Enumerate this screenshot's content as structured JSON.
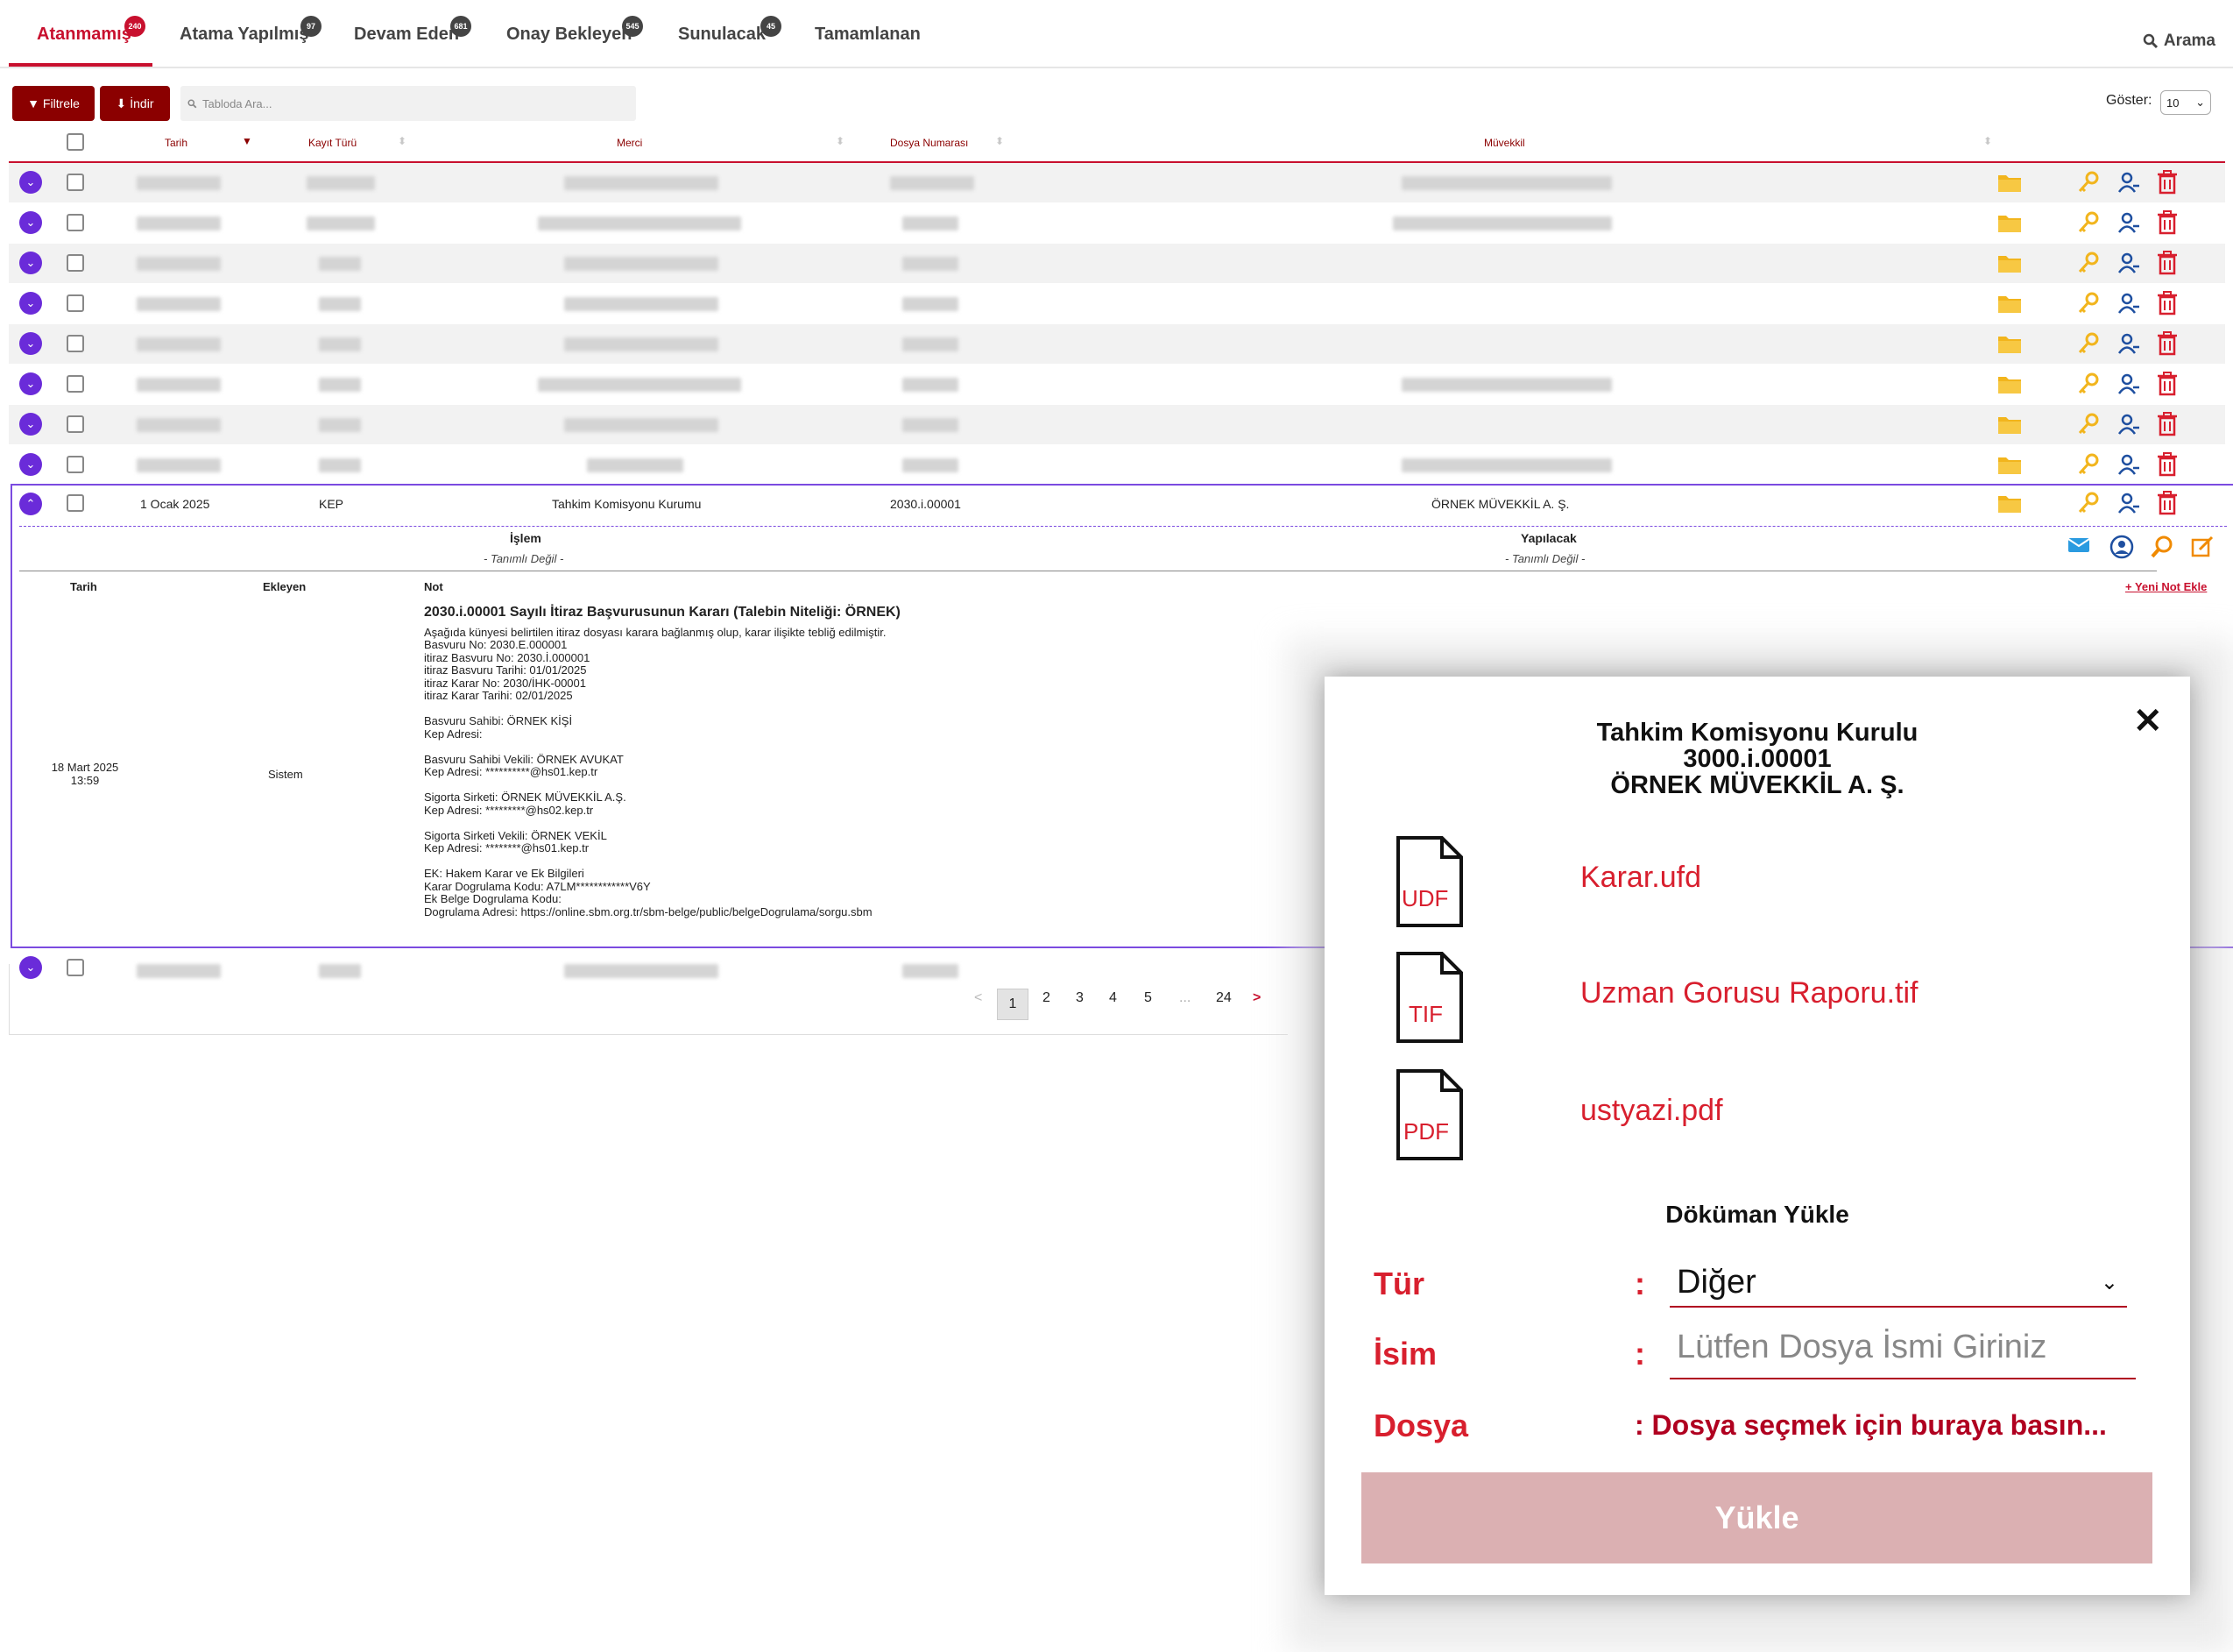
{
  "tabs": [
    {
      "label": "Atanmamış",
      "badge": "240"
    },
    {
      "label": "Atama Yapılmış",
      "badge": "97"
    },
    {
      "label": "Devam Eden",
      "badge": "681"
    },
    {
      "label": "Onay Bekleyen",
      "badge": "545"
    },
    {
      "label": "Sunulacak",
      "badge": "45"
    },
    {
      "label": "Tamamlanan",
      "badge": ""
    }
  ],
  "search_tab": {
    "label": "Arama",
    "icon": "search-icon"
  },
  "toolbar": {
    "filter_label": "Filtrele",
    "download_label": "İndir",
    "table_search_placeholder": "Tabloda Ara...",
    "show_label": "Göster:",
    "show_value": "10"
  },
  "table": {
    "columns": [
      "Tarih",
      "Kayıt Türü",
      "Merci",
      "Dosya Numarası",
      "Müvekkil"
    ],
    "expanded_row": {
      "date": "1 Ocak 2025",
      "type": "KEP",
      "merci": "Tahkim Komisyonu Kurumu",
      "file_no": "2030.i.00001",
      "client": "ÖRNEK MÜVEKKİL A. Ş."
    },
    "detail": {
      "islem_label": "İşlem",
      "islem_value": "- Tanımlı Değil -",
      "yapilacak_label": "Yapılacak",
      "yapilacak_value": "- Tanımlı Değil -",
      "col_tarih": "Tarih",
      "col_ekleyen": "Ekleyen",
      "col_not": "Not",
      "add_note": "+ Yeni Not Ekle",
      "note_date": "18 Mart 2025",
      "note_time": "13:59",
      "note_author": "Sistem",
      "note_title": "2030.i.00001 Sayılı İtiraz Başvurusunun Kararı (Talebin Niteliği: ÖRNEK)",
      "note_lines": [
        "Aşağıda künyesi belirtilen itiraz dosyası karara bağlanmış olup, karar ilişikte tebliğ edilmiştir.",
        "Basvuru No: 2030.E.000001",
        "itiraz Basvuru No: 2030.İ.000001",
        "itiraz Basvuru Tarihi: 01/01/2025",
        "itiraz Karar No: 2030/İHK-00001",
        "itiraz Karar Tarihi: 02/01/2025",
        "",
        "Basvuru Sahibi: ÖRNEK KİŞİ",
        "Kep Adresi:",
        "",
        "Basvuru Sahibi Vekili: ÖRNEK AVUKAT",
        "Kep Adresi: **********@hs01.kep.tr",
        "",
        "Sigorta Sirketi: ÖRNEK MÜVEKKİL A.Ş.",
        "Kep Adresi: *********@hs02.kep.tr",
        "",
        "Sigorta Sirketi Vekili: ÖRNEK VEKİL",
        "Kep Adresi: ********@hs01.kep.tr",
        "",
        "EK: Hakem Karar ve Ek Bilgileri",
        "Karar Dogrulama Kodu: A7LM************V6Y",
        "Ek Belge Dogrulama Kodu:",
        "Dogrulama Adresi: https://online.sbm.org.tr/sbm-belge/public/belgeDogrulama/sorgu.sbm"
      ]
    }
  },
  "pagination": {
    "prev": "<",
    "pages": [
      "1",
      "2",
      "3",
      "4",
      "5",
      "...",
      "24"
    ],
    "next": ">",
    "current": "1"
  },
  "modal": {
    "title_line1": "Tahkim Komisyonu Kurulu",
    "title_line2": "3000.i.00001",
    "title_line3": "ÖRNEK MÜVEKKİL A. Ş.",
    "files": [
      {
        "ext": "UDF",
        "name": "Karar.ufd"
      },
      {
        "ext": "TIF",
        "name": "Uzman Gorusu Raporu.tif"
      },
      {
        "ext": "PDF",
        "name": "ustyazi.pdf"
      }
    ],
    "upload_title": "Döküman Yükle",
    "type_label": "Tür",
    "type_value": "Diğer",
    "name_label": "İsim",
    "name_placeholder": "Lütfen Dosya İsmi Giriniz",
    "file_label": "Dosya",
    "file_pick": ": Dosya seçmek için buraya basın...",
    "upload_button": "Yükle",
    "colon": ":"
  },
  "colors": {
    "accent": "#c8102e",
    "dark_red": "#8b0000",
    "purple": "#6a2bd9",
    "folder": "#f2b51d"
  }
}
